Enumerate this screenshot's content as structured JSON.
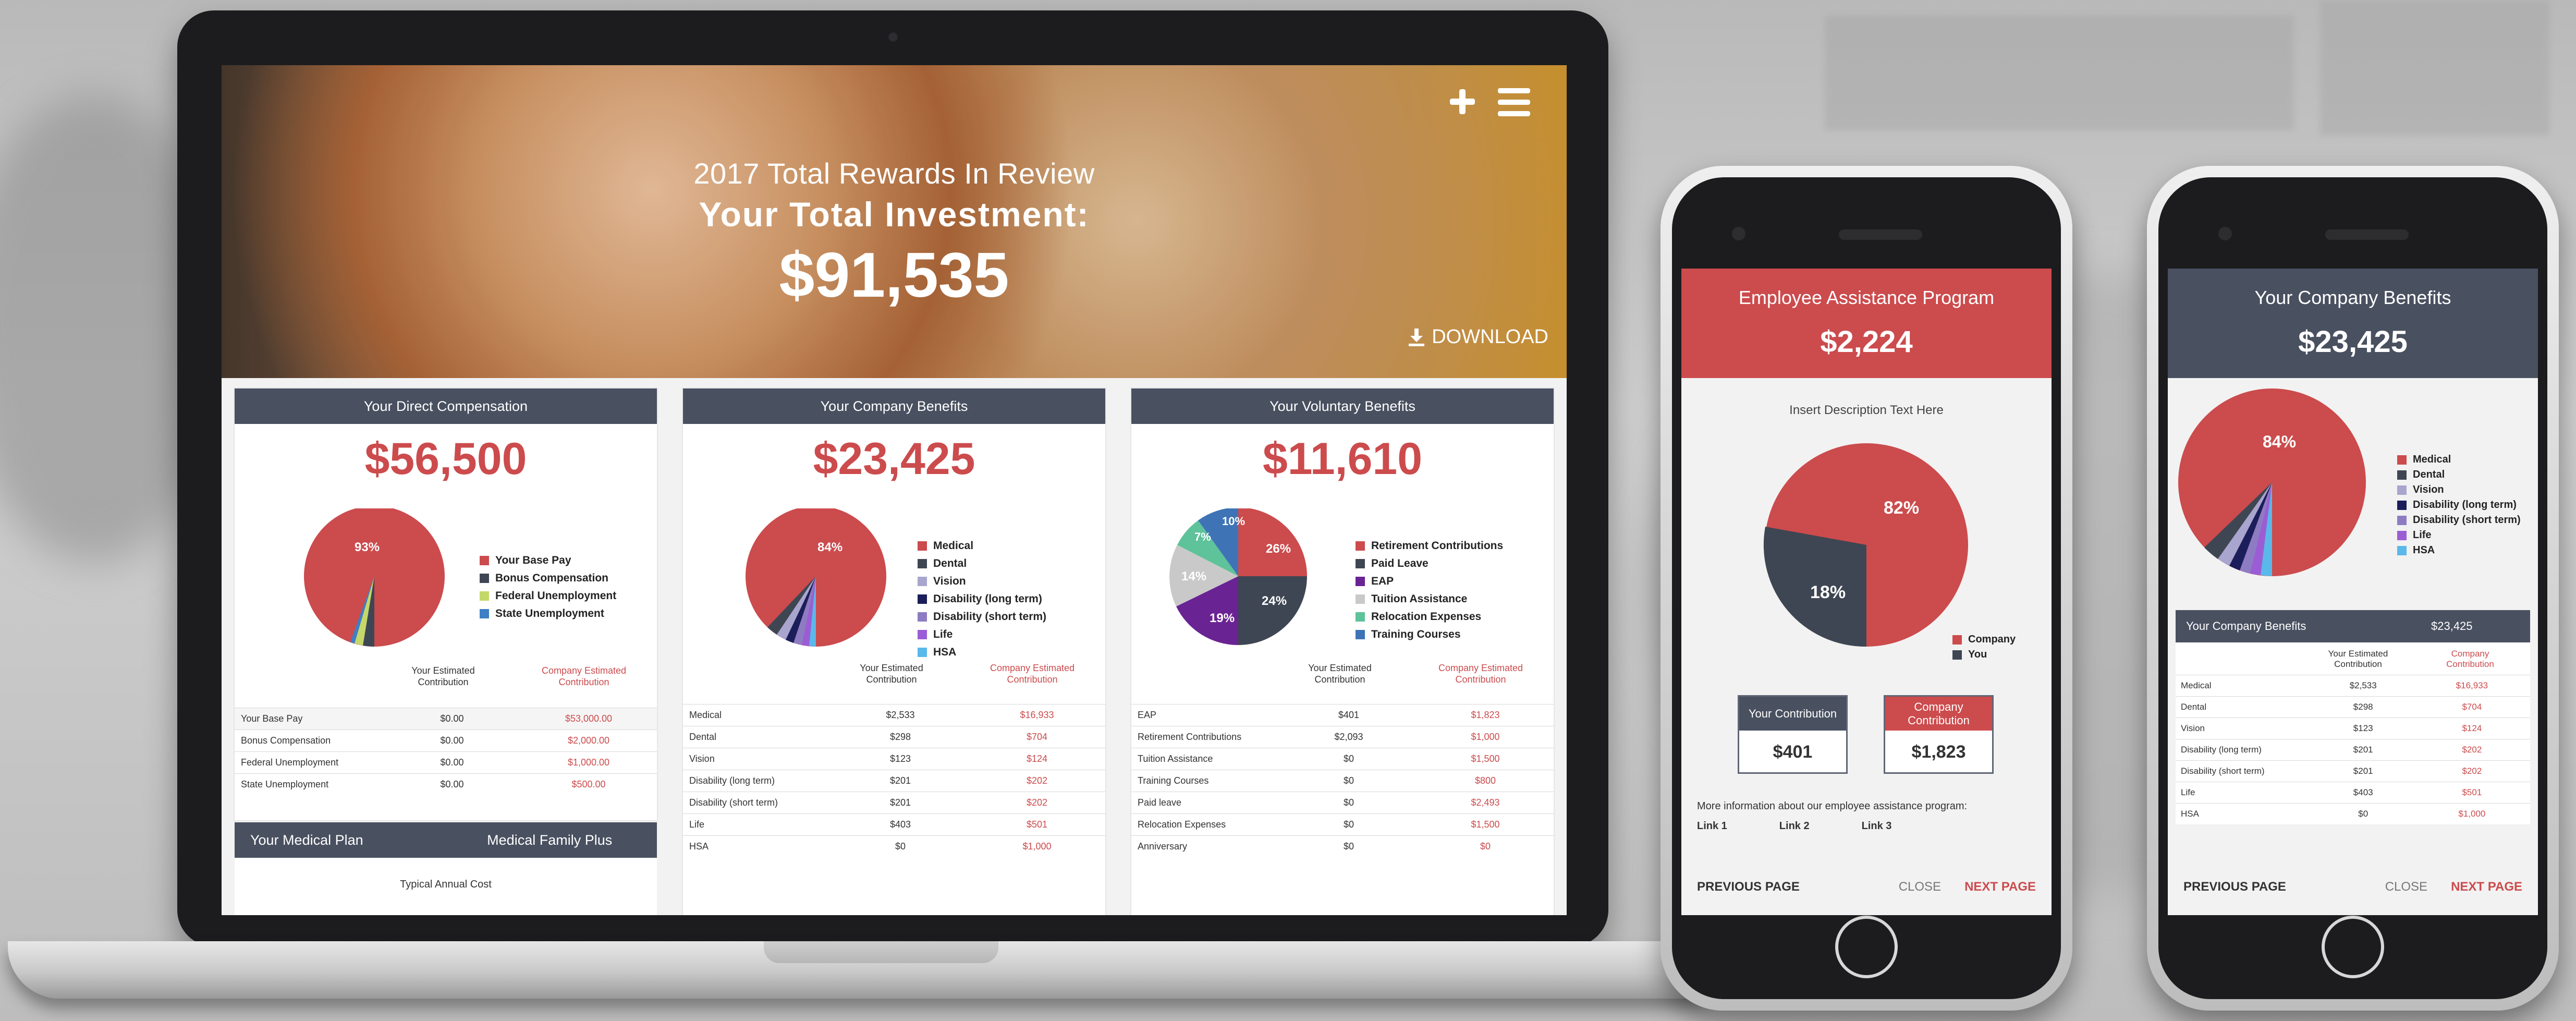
{
  "colors": {
    "header": "#495060",
    "accent": "#cc4b4d",
    "dark": "#3f4653"
  },
  "laptop": {
    "hero": {
      "subtitle": "2017 Total Rewards In Review",
      "title": "Your Total Investment:",
      "amount": "$91,535",
      "download": "DOWNLOAD"
    },
    "card1": {
      "title": "Your Direct Compensation",
      "amount": "$56,500",
      "pie_label": "93%",
      "legend": [
        "Your Base Pay",
        "Bonus Compensation",
        "Federal Unemployment",
        "State Unemployment"
      ],
      "col_you": "Your Estimated\nContribution",
      "col_company": "Company Estimated\nContribution",
      "rows": [
        {
          "label": "Your Base Pay",
          "you": "$0.00",
          "company": "$53,000.00"
        },
        {
          "label": "Bonus Compensation",
          "you": "$0.00",
          "company": "$2,000.00"
        },
        {
          "label": "Federal Unemployment",
          "you": "$0.00",
          "company": "$1,000.00"
        },
        {
          "label": "State Unemployment",
          "you": "$0.00",
          "company": "$500.00"
        }
      ]
    },
    "card2": {
      "title": "Your Company Benefits",
      "amount": "$23,425",
      "pie_label": "84%",
      "legend": [
        "Medical",
        "Dental",
        "Vision",
        "Disability (long term)",
        "Disability (short term)",
        "Life",
        "HSA"
      ],
      "col_you": "Your Estimated\nContribution",
      "col_company": "Company Estimated\nContribution",
      "rows": [
        {
          "label": "Medical",
          "you": "$2,533",
          "company": "$16,933"
        },
        {
          "label": "Dental",
          "you": "$298",
          "company": "$704"
        },
        {
          "label": "Vision",
          "you": "$123",
          "company": "$124"
        },
        {
          "label": "Disability (long term)",
          "you": "$201",
          "company": "$202"
        },
        {
          "label": "Disability (short term)",
          "you": "$201",
          "company": "$202"
        },
        {
          "label": "Life",
          "you": "$403",
          "company": "$501"
        },
        {
          "label": "HSA",
          "you": "$0",
          "company": "$1,000"
        }
      ]
    },
    "card3": {
      "title": "Your Voluntary Benefits",
      "amount": "$11,610",
      "pie_labels": [
        "26%",
        "24%",
        "19%",
        "14%",
        "7%",
        "10%"
      ],
      "legend": [
        "Retirement Contributions",
        "Paid Leave",
        "EAP",
        "Tuition Assistance",
        "Relocation Expenses",
        "Training Courses"
      ],
      "col_you": "Your Estimated\nContribution",
      "col_company": "Company Estimated\nContribution",
      "rows": [
        {
          "label": "EAP",
          "you": "$401",
          "company": "$1,823"
        },
        {
          "label": "Retirement Contributions",
          "you": "$2,093",
          "company": "$1,000"
        },
        {
          "label": "Tuition Assistance",
          "you": "$0",
          "company": "$1,500"
        },
        {
          "label": "Training Courses",
          "you": "$0",
          "company": "$800"
        },
        {
          "label": "Paid leave",
          "you": "$0",
          "company": "$2,493"
        },
        {
          "label": "Relocation Expenses",
          "you": "$0",
          "company": "$1,500"
        },
        {
          "label": "Anniversary",
          "you": "$0",
          "company": "$0"
        }
      ]
    },
    "medical_plan": {
      "left": "Your Medical Plan",
      "right": "Medical Family Plus",
      "sub": "Typical Annual Cost"
    }
  },
  "phone1": {
    "title": "Employee Assistance Program",
    "amount": "$2,224",
    "desc": "Insert Description Text Here",
    "pie_labels": [
      "82%",
      "18%"
    ],
    "legend": [
      "Company",
      "You"
    ],
    "box_you": {
      "label": "Your Contribution",
      "value": "$401"
    },
    "box_company": {
      "label": "Company Contribution",
      "value": "$1,823"
    },
    "more": "More information about our employee assistance program:",
    "links": [
      "Link 1",
      "Link 2",
      "Link 3"
    ],
    "nav": {
      "prev": "PREVIOUS PAGE",
      "close": "CLOSE",
      "next": "NEXT PAGE"
    }
  },
  "phone2": {
    "title": "Your Company Benefits",
    "amount": "$23,425",
    "pie_label": "84%",
    "legend": [
      "Medical",
      "Dental",
      "Vision",
      "Disability (long term)",
      "Disability (short term)",
      "Life",
      "HSA"
    ],
    "table_title": "Your Company Benefits",
    "table_amount": "$23,425",
    "col_you": "Your Estimated\nContribution",
    "col_company": "Company\nContribution",
    "rows": [
      {
        "label": "Medical",
        "you": "$2,533",
        "company": "$16,933"
      },
      {
        "label": "Dental",
        "you": "$298",
        "company": "$704"
      },
      {
        "label": "Vision",
        "you": "$123",
        "company": "$124"
      },
      {
        "label": "Disability (long term)",
        "you": "$201",
        "company": "$202"
      },
      {
        "label": "Disability (short term)",
        "you": "$201",
        "company": "$202"
      },
      {
        "label": "Life",
        "you": "$403",
        "company": "$501"
      },
      {
        "label": "HSA",
        "you": "$0",
        "company": "$1,000"
      }
    ],
    "nav": {
      "prev": "PREVIOUS PAGE",
      "close": "CLOSE",
      "next": "NEXT PAGE"
    }
  }
}
